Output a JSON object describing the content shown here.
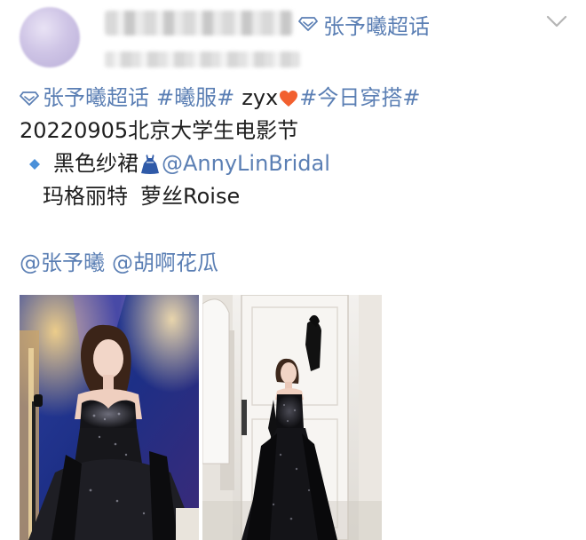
{
  "header": {
    "super_topic_tag": "张予曦超话",
    "icons": {
      "tag": "diamond-icon",
      "menu": "chevron-down-icon"
    }
  },
  "post": {
    "line1": {
      "topic_super": "张予曦超话",
      "hashtag_1": "#曦服#",
      "plain": "zyx",
      "hashtag_2": "#今日穿搭#"
    },
    "line2": "20220905北京大学生电影节",
    "line3": {
      "item": "黑色纱裙",
      "mention": "@AnnyLinBridal"
    },
    "line4": {
      "brand_1": "玛格丽特",
      "brand_2": "萝丝Roise"
    },
    "mentions": [
      "@张予曦",
      "@胡啊花瓜"
    ]
  },
  "colors": {
    "link": "#5b7fb4",
    "text": "#1e1e1e",
    "heart": "#f2602f",
    "bullet": "#4a90d9"
  }
}
